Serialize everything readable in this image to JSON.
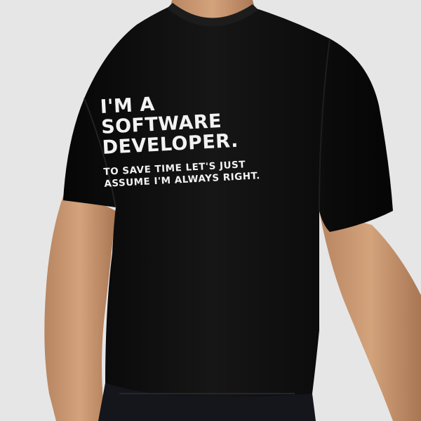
{
  "product": {
    "shirt_color": "#0e0e0e",
    "skin_color": "#c7976f",
    "background_color": "#e6e6e6",
    "print": {
      "headline": "I'M A\nSOFTWARE\nDEVELOPER.",
      "subline": "TO SAVE TIME LET'S JUST\nASSUME I'M ALWAYS RIGHT.",
      "text_color": "#f2f2f2"
    }
  }
}
